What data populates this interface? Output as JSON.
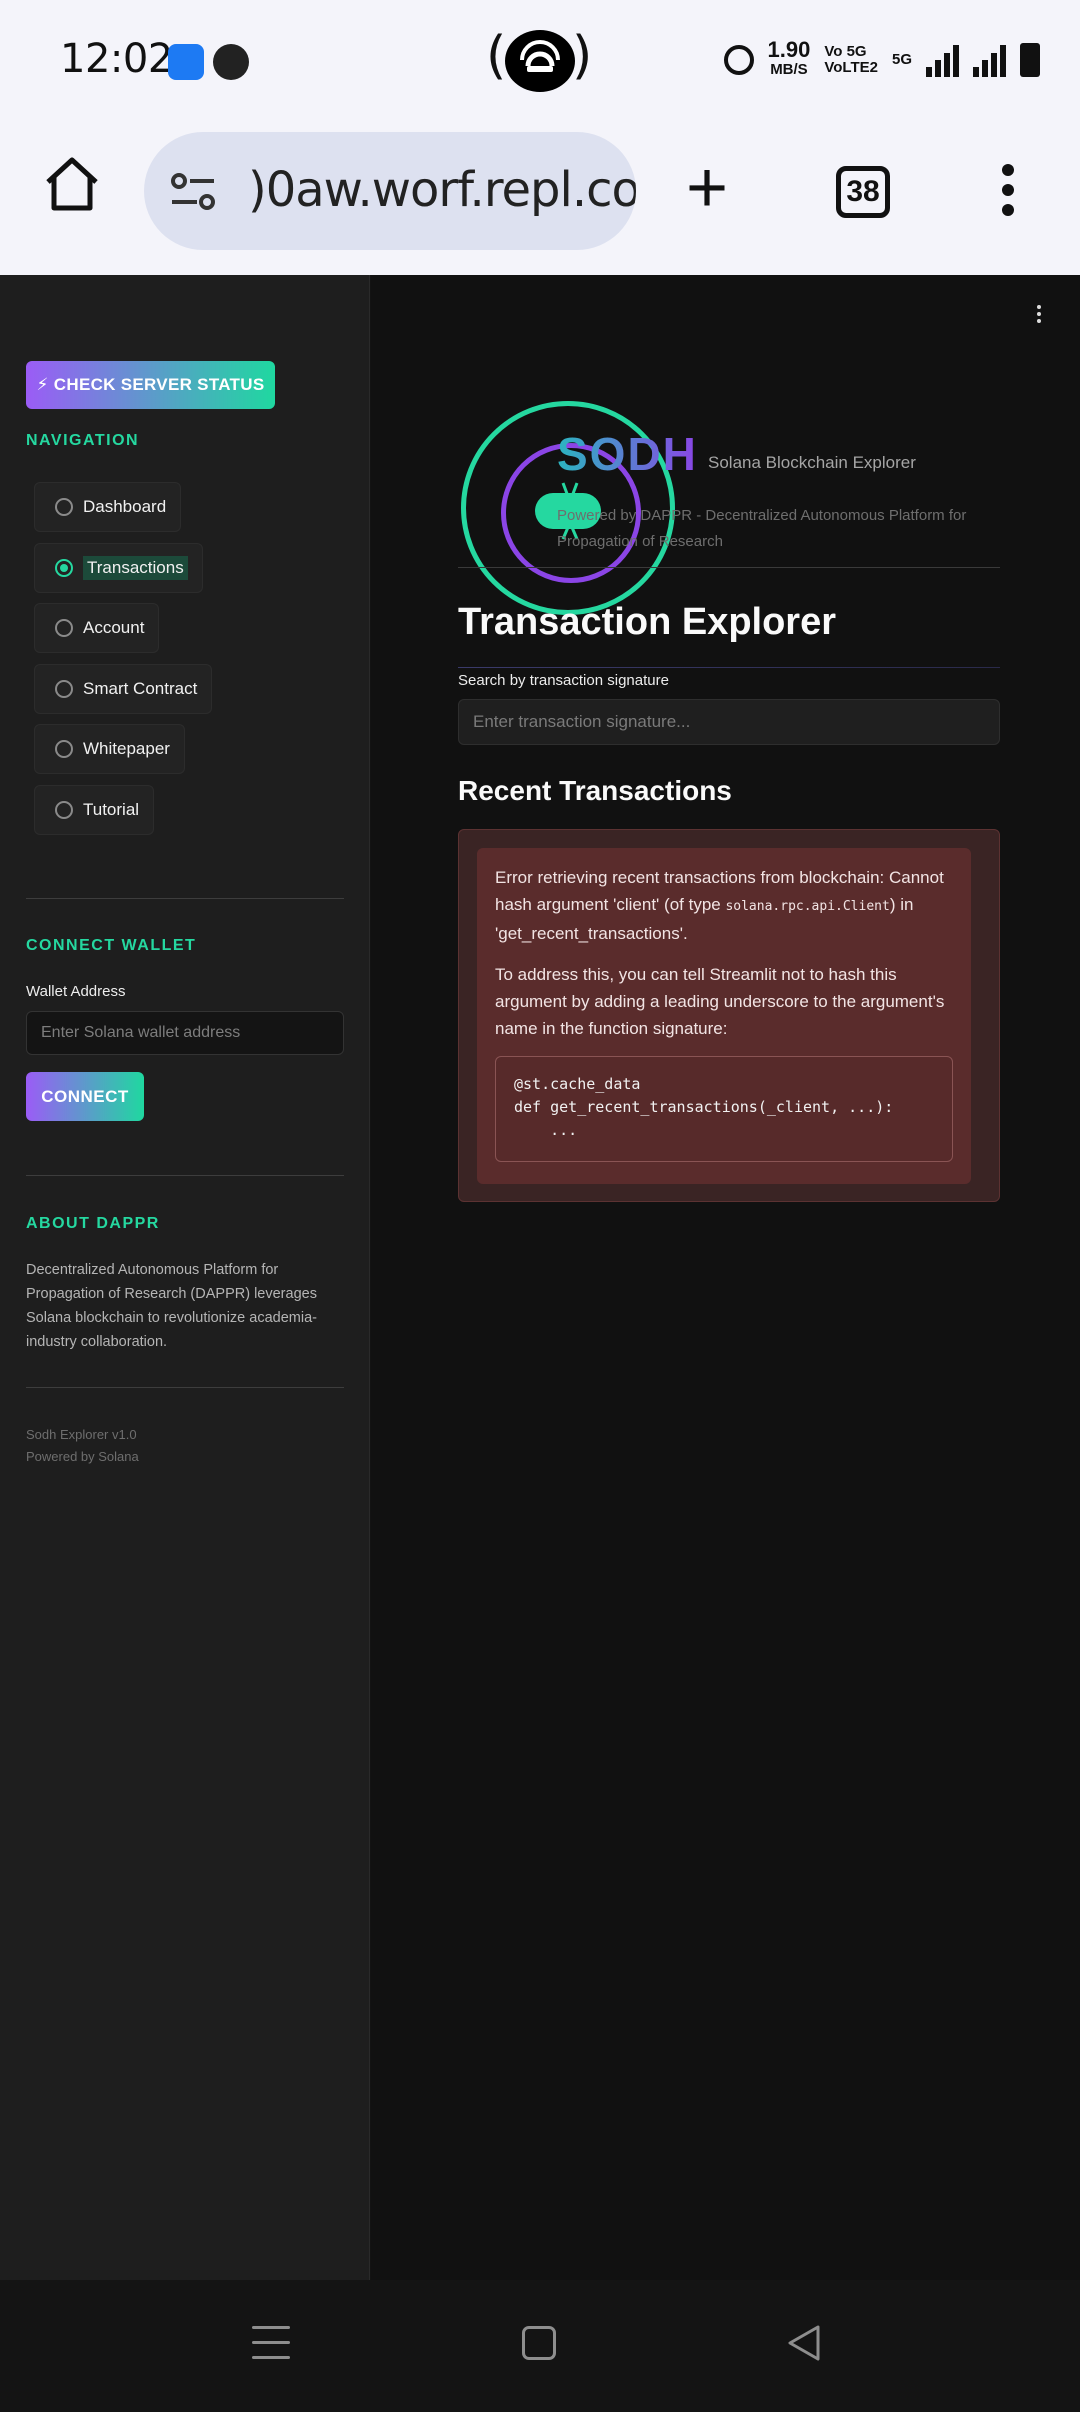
{
  "status_bar": {
    "time": "12:02",
    "net_speed_value": "1.90",
    "net_speed_unit": "MB/S",
    "volte_tag": "Vo 5G\nVoLTE2",
    "network_tag": "5G",
    "icons": [
      "android-app-icon",
      "github-app-icon",
      "hotspot-icon",
      "alarm-icon",
      "signal-icon",
      "signal-icon",
      "battery-icon"
    ]
  },
  "browser": {
    "url": ")0aw.worf.repl.co",
    "tab_count": "38"
  },
  "sidebar": {
    "check_status_label": "⚡ CHECK SERVER STATUS",
    "nav_heading": "NAVIGATION",
    "nav_items": [
      {
        "label": "Dashboard",
        "selected": false
      },
      {
        "label": "Transactions",
        "selected": true
      },
      {
        "label": "Account",
        "selected": false
      },
      {
        "label": "Smart Contract",
        "selected": false
      },
      {
        "label": "Whitepaper",
        "selected": false
      },
      {
        "label": "Tutorial",
        "selected": false
      }
    ],
    "wallet_heading": "CONNECT WALLET",
    "wallet_label": "Wallet Address",
    "wallet_placeholder": "Enter Solana wallet address",
    "connect_label": "CONNECT",
    "about_heading": "ABOUT DAPPR",
    "about_text": "Decentralized Autonomous Platform for Propagation of Research (DAPPR) leverages Solana blockchain to revolutionize academia-industry collaboration.",
    "footer_version": "Sodh Explorer v1.0",
    "footer_powered": "Powered by Solana"
  },
  "header": {
    "brand": "SODH",
    "subtitle": "Solana Blockchain Explorer",
    "powered_by": "Powered by DAPPR - Decentralized Autonomous Platform for Propagation of Research"
  },
  "main": {
    "title": "Transaction Explorer",
    "search_label": "Search by transaction signature",
    "search_placeholder": "Enter transaction signature...",
    "recent_title": "Recent Transactions",
    "error_p1_before": "Error retrieving recent transactions from blockchain: Cannot hash argument 'client' (of type ",
    "error_p1_code": "solana.rpc.api.Client",
    "error_p1_after": ") in 'get_recent_transactions'.",
    "error_p2": "To address this, you can tell Streamlit not to hash this argument by adding a leading underscore to the argument's name in the function signature:",
    "code": "@st.cache_data\ndef get_recent_transactions(_client, ...):\n    ..."
  },
  "colors": {
    "accent_green": "#25d8a0",
    "accent_purple": "#8b45e6",
    "error_bg": "#5a2c2c"
  }
}
